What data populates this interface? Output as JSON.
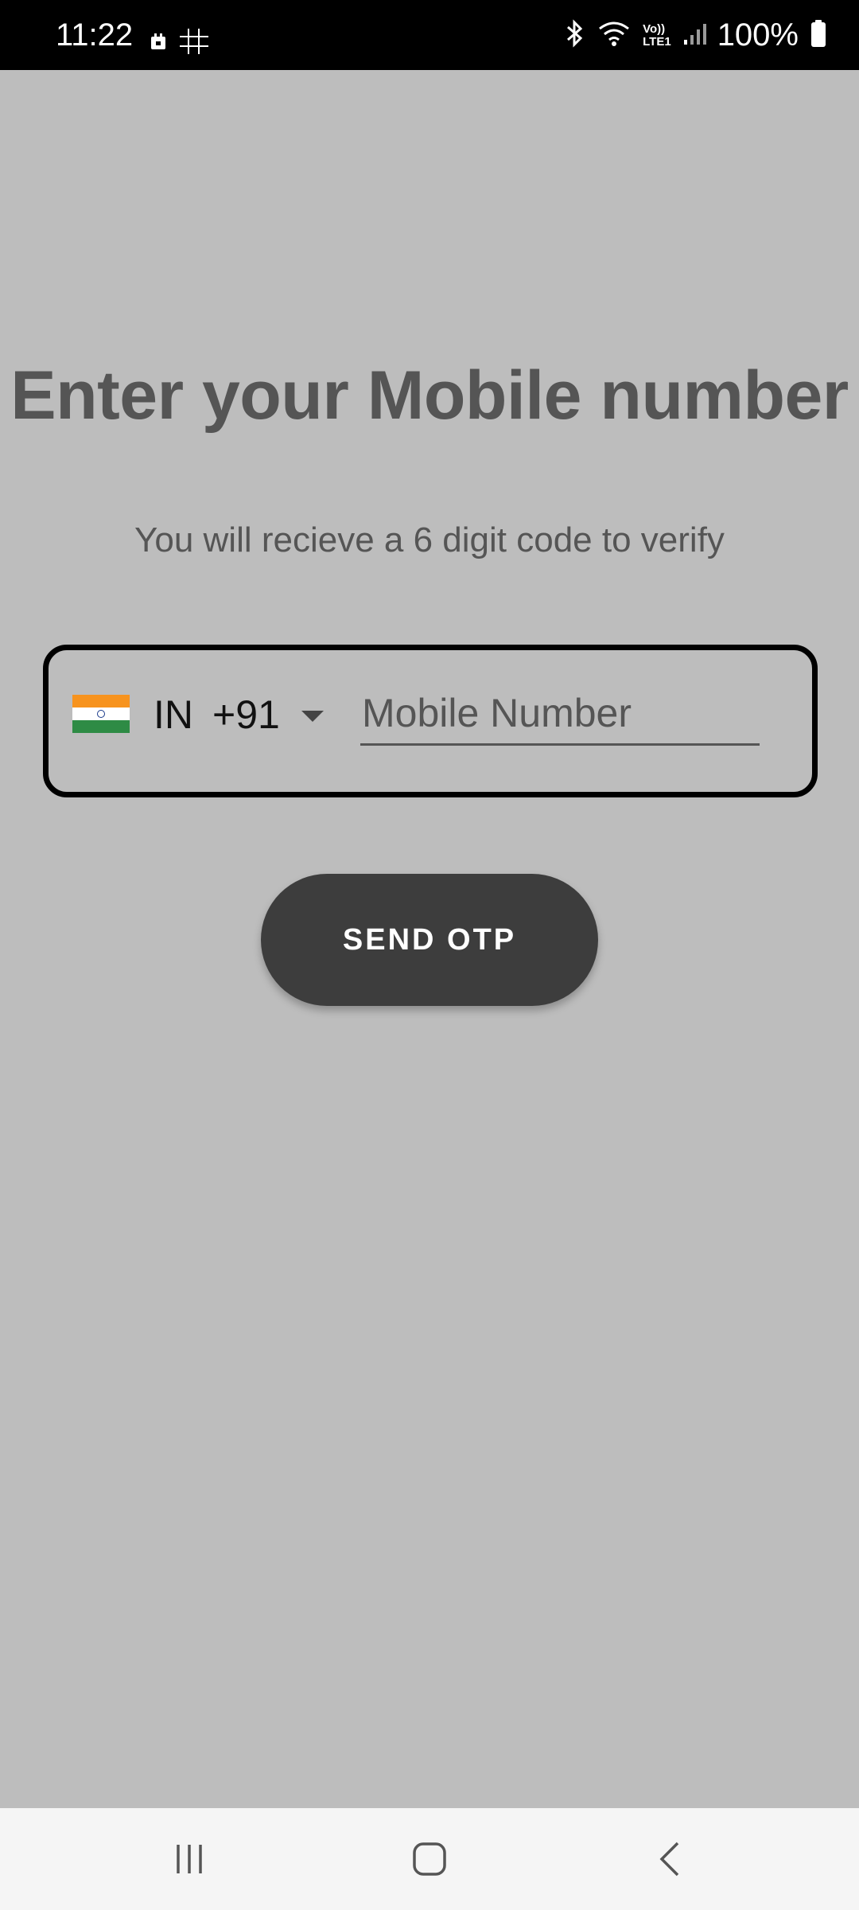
{
  "status_bar": {
    "time": "11:22",
    "battery_text": "100%",
    "icons": [
      "calendar-icon",
      "grid-game-icon",
      "bluetooth-icon",
      "wifi-icon",
      "volte-icon",
      "signal-icon",
      "battery-icon"
    ],
    "volte_label_top": "Vo))",
    "volte_label_bottom": "LTE1"
  },
  "main": {
    "title": "Enter your Mobile number",
    "subtitle": "You will recieve a 6 digit code to verify",
    "phone_field": {
      "country_iso": "IN",
      "dial_code": "+91",
      "placeholder": "Mobile Number",
      "value": ""
    },
    "send_button_label": "SEND OTP"
  },
  "colors": {
    "background": "#bdbdbd",
    "title_text": "#555555",
    "button_bg": "#3d3d3d",
    "button_text": "#ffffff",
    "nav_bar_bg": "#f5f5f5"
  },
  "nav_bar": {
    "buttons": [
      "recents-icon",
      "home-icon",
      "back-icon"
    ]
  }
}
